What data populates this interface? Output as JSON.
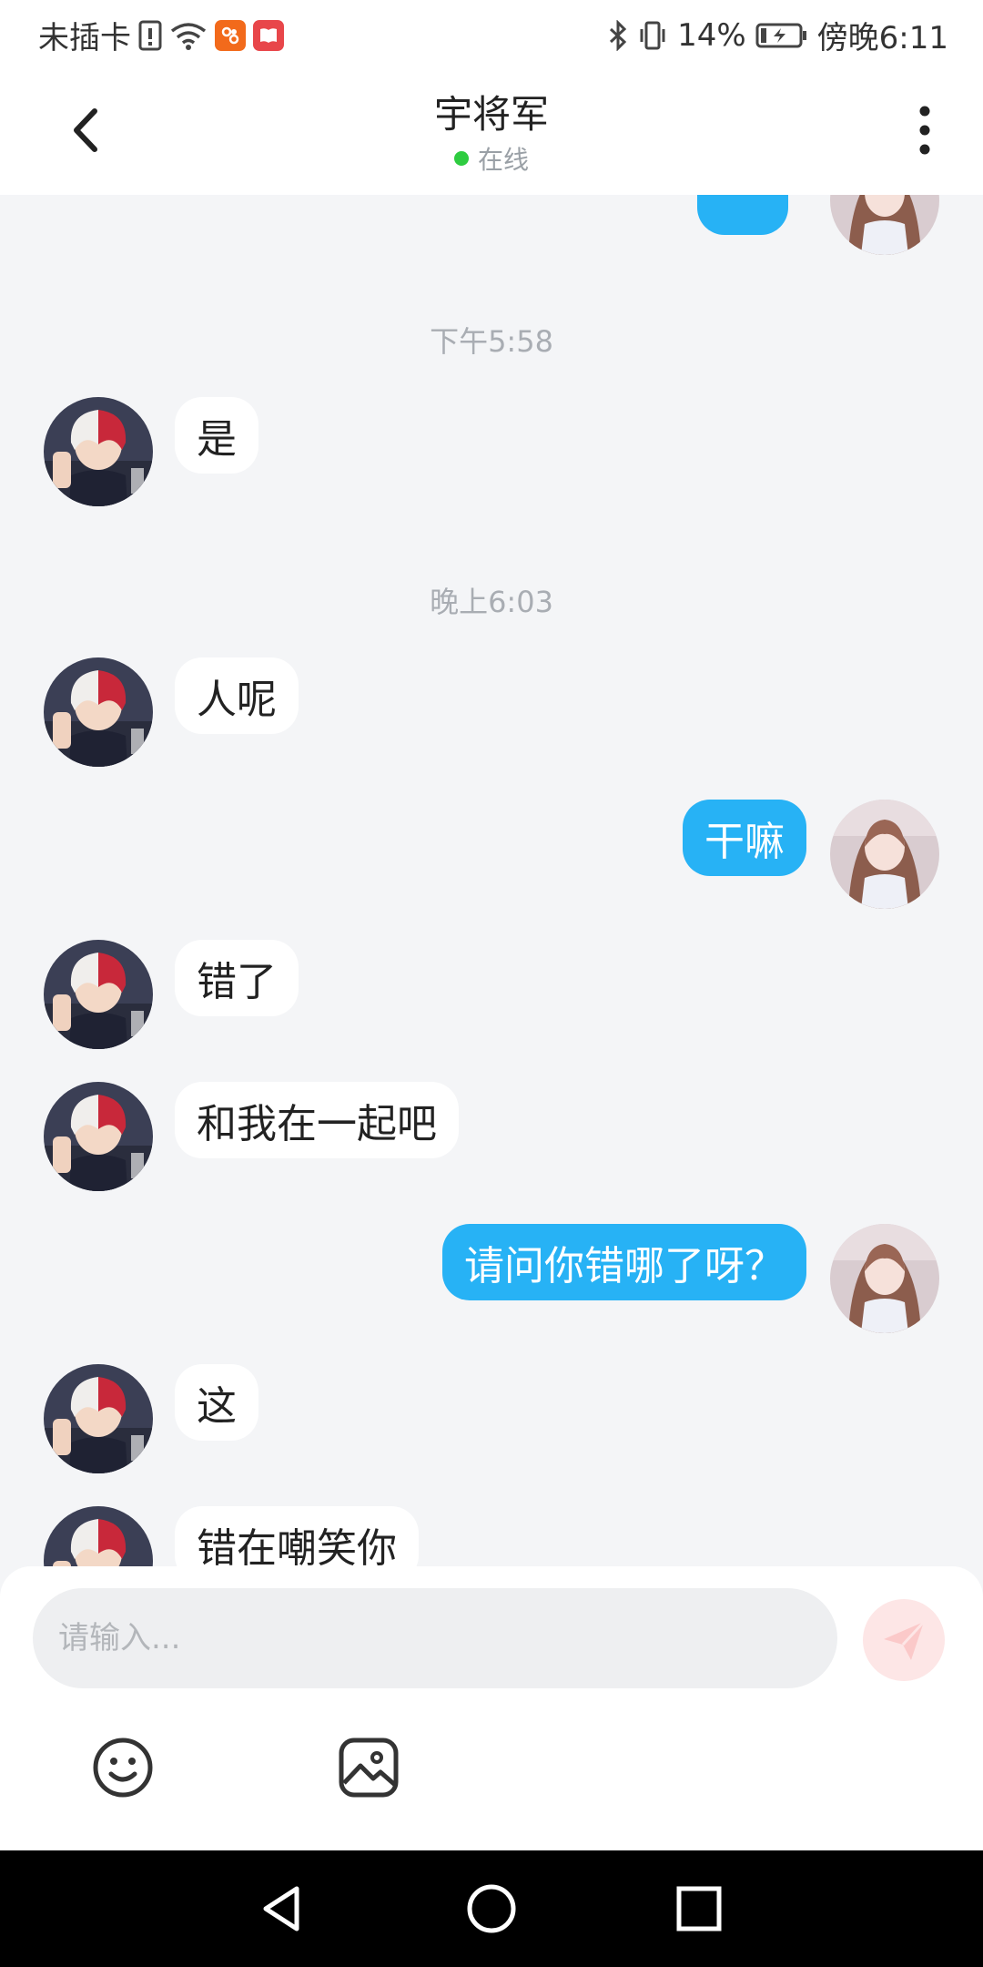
{
  "status_bar": {
    "carrier": "未插卡",
    "battery": "14%",
    "time": "傍晚6:11"
  },
  "header": {
    "contact_name": "宇将军",
    "status": "在线"
  },
  "messages": [
    {
      "type": "time",
      "text": "下午5:58"
    },
    {
      "from": "them",
      "text": "是"
    },
    {
      "type": "time",
      "text": "晚上6:03"
    },
    {
      "from": "them",
      "text": "人呢"
    },
    {
      "from": "me",
      "text": "干嘛"
    },
    {
      "from": "them",
      "text": "错了"
    },
    {
      "from": "them",
      "text": "和我在一起吧"
    },
    {
      "from": "me",
      "text": "请问你错哪了呀？"
    },
    {
      "from": "them",
      "text": "这"
    },
    {
      "from": "them",
      "text": "错在嘲笑你"
    }
  ],
  "composer": {
    "placeholder": "请输入...",
    "value": ""
  },
  "colors": {
    "outgoing_bubble": "#27b2f5",
    "incoming_bubble": "#ffffff",
    "online_dot": "#2ecc40",
    "send_button": "#fde6e6"
  },
  "icons": {
    "back": "chevron-left-icon",
    "more": "vertical-dots-icon",
    "emoji": "smiley-icon",
    "image": "image-icon",
    "send": "paper-plane-icon"
  }
}
